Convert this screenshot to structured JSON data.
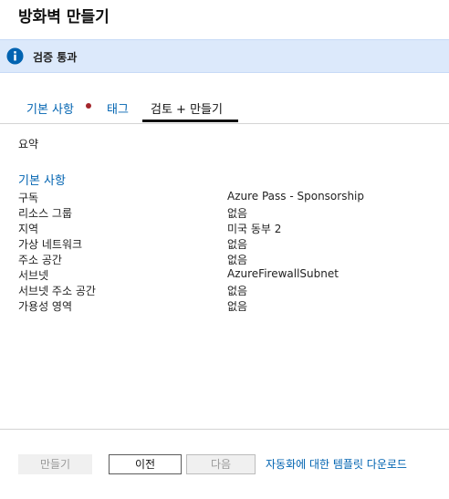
{
  "page": {
    "title": "방화벽 만들기"
  },
  "banner": {
    "icon": "info-icon",
    "text": "검증 통과",
    "colors": {
      "background": "#dce9fb",
      "icon": "#0063b1"
    }
  },
  "tabs": [
    {
      "label": "기본 사항",
      "has_error_dot": true
    },
    {
      "label": "태그"
    },
    {
      "label": "검토 + 만들기",
      "active": true
    }
  ],
  "summary": {
    "label": "요약",
    "section_title": "기본 사항",
    "rows": [
      {
        "label": "구독",
        "value": "Azure Pass - Sponsorship"
      },
      {
        "label": "리소스 그룹",
        "value": "없음"
      },
      {
        "label": "지역",
        "value": "미국 동부 2"
      },
      {
        "label": "가상 네트워크",
        "value": "없음"
      },
      {
        "label": "주소 공간",
        "value": "없음"
      },
      {
        "label": "서브넷",
        "value": "AzureFirewallSubnet"
      },
      {
        "label": "서브넷 주소 공간",
        "value": "없음"
      },
      {
        "label": "가용성 영역",
        "value": "없음"
      }
    ]
  },
  "footer": {
    "create_label": "만들기",
    "prev_label": "이전",
    "next_label": "다음",
    "download_link": "자동화에 대한 템플릿 다운로드"
  },
  "colors": {
    "link": "#0063b1",
    "error_dot": "#a4262c"
  }
}
